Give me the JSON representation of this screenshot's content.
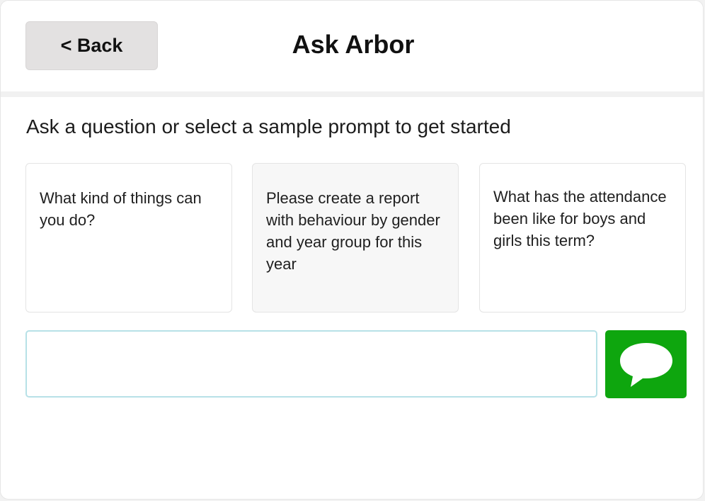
{
  "header": {
    "back_label": "< Back",
    "title": "Ask Arbor"
  },
  "main": {
    "instruction": "Ask a question or select a sample prompt to get started",
    "prompts": [
      {
        "text": "What kind of things can you do?"
      },
      {
        "text": "Please create a report with behaviour by gender and year group for this year"
      },
      {
        "text": "What has the attendance been like for boys and girls this term?"
      }
    ],
    "input": {
      "value": "",
      "placeholder": ""
    },
    "send_button": {
      "icon": "speech-bubble-icon",
      "color": "#0ea60e"
    }
  }
}
